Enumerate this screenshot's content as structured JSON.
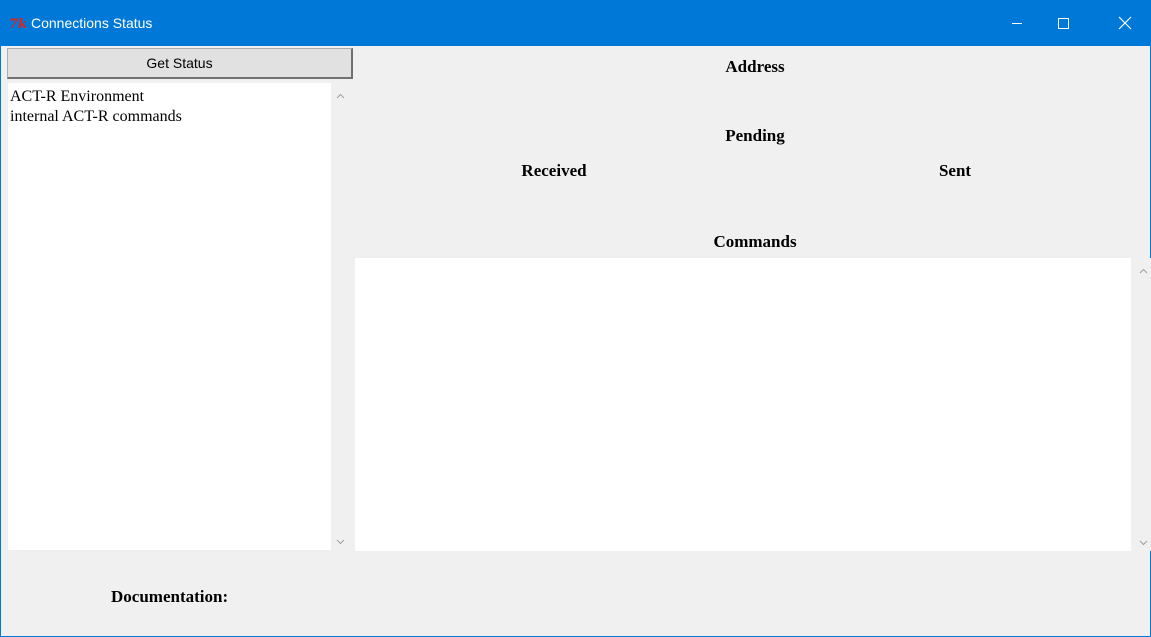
{
  "window": {
    "title": "Connections Status",
    "app_icon": "tk-feather-icon",
    "accent_color": "#0078d7",
    "controls": {
      "minimize_icon": "minimize-icon",
      "maximize_icon": "maximize-icon",
      "close_icon": "close-icon"
    }
  },
  "toolbar": {
    "get_status_label": "Get Status"
  },
  "connections": {
    "items": [
      "ACT-R Environment",
      "internal ACT-R commands"
    ]
  },
  "details": {
    "address_label": "Address",
    "pending_label": "Pending",
    "received_label": "Received",
    "sent_label": "Sent",
    "commands_label": "Commands",
    "documentation_label": "Documentation:"
  }
}
